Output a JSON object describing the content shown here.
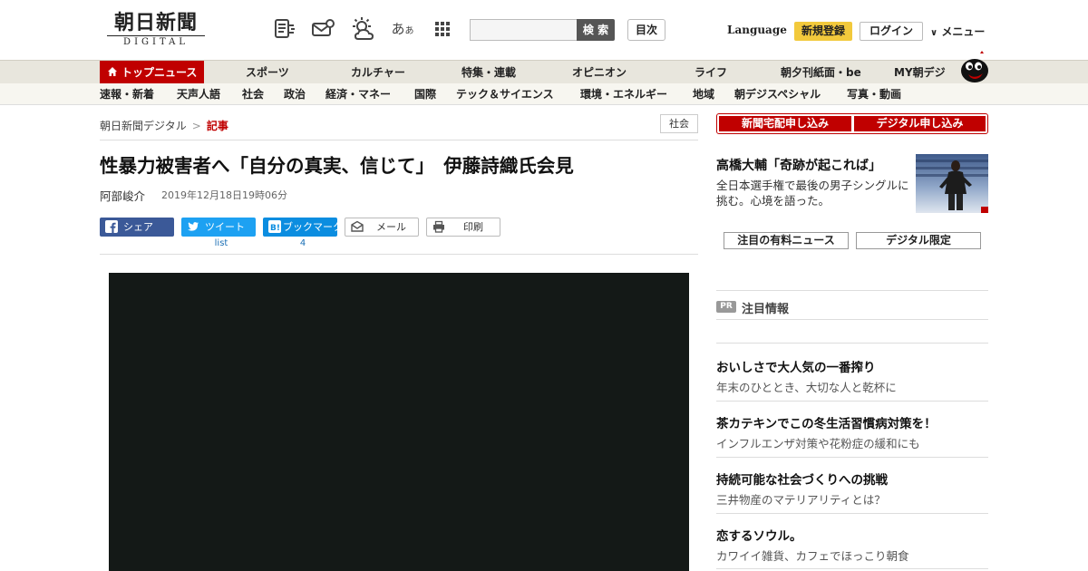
{
  "header": {
    "logo_main": "朝日新聞",
    "logo_sub": "DIGITAL",
    "search_button": "検 索",
    "index_button": "目次",
    "language_link": "Language",
    "register_button": "新規登録",
    "login_button": "ログイン",
    "menu_button": "メニュー",
    "font_size_icon_large": "あ",
    "font_size_icon_small": "あ"
  },
  "nav_primary": [
    {
      "label": "トップニュース",
      "active": true
    },
    {
      "label": "スポーツ"
    },
    {
      "label": "カルチャー"
    },
    {
      "label": "特集・連載"
    },
    {
      "label": "オピニオン"
    },
    {
      "label": "ライフ"
    },
    {
      "label": "朝夕刊紙面・be"
    },
    {
      "label": "MY朝デジ"
    }
  ],
  "nav_secondary": [
    "速報・新着",
    "天声人語",
    "社会",
    "政治",
    "経済・マネー",
    "国際",
    "テック＆サイエンス",
    "環境・エネルギー",
    "地域",
    "朝デジスペシャル",
    "写真・動画"
  ],
  "article": {
    "breadcrumb_home": "朝日新聞デジタル",
    "breadcrumb_sep": ">",
    "breadcrumb_current": "記事",
    "category": "社会",
    "headline": "性暴力被害者へ「自分の真実、信じて」　伊藤詩織氏会見",
    "author": "阿部峻介",
    "date": "2019年12月18日19時06分"
  },
  "share": {
    "facebook": "シェア",
    "twitter": "ツイート",
    "twitter_count": "list",
    "hatena": "ブックマーク",
    "hatena_count": "4",
    "mail": "メール",
    "print": "印刷"
  },
  "sidebar": {
    "promo_delivery": "新聞宅配申し込み",
    "promo_digital": "デジタル申し込み",
    "feature_title": "高橋大輔「奇跡が起これば」",
    "feature_desc": "全日本選手権で最後の男子シングルに挑む。心境を語った。",
    "tab_premium": "注目の有料ニュース",
    "tab_digital": "デジタル限定",
    "pr_badge": "PR",
    "pr_heading": "注目情報",
    "pr_items": [
      {
        "title": "おいしさで大人気の一番搾り",
        "sub": "年末のひととき、大切な人と乾杯に"
      },
      {
        "title": "茶カテキンでこの冬生活習慣病対策を！",
        "sub": "インフルエンザ対策や花粉症の緩和にも"
      },
      {
        "title": "持続可能な社会づくりへの挑戦",
        "sub": "三井物産のマテリアリティとは？"
      },
      {
        "title": "恋するソウル。",
        "sub": "カワイイ雑貨、カフェでほっこり朝食"
      }
    ]
  },
  "colors": {
    "brand_red": "#c00000",
    "register_yellow": "#f2c93c",
    "facebook": "#3b5998",
    "twitter": "#1da1f2",
    "hatena": "#0b8de0"
  }
}
